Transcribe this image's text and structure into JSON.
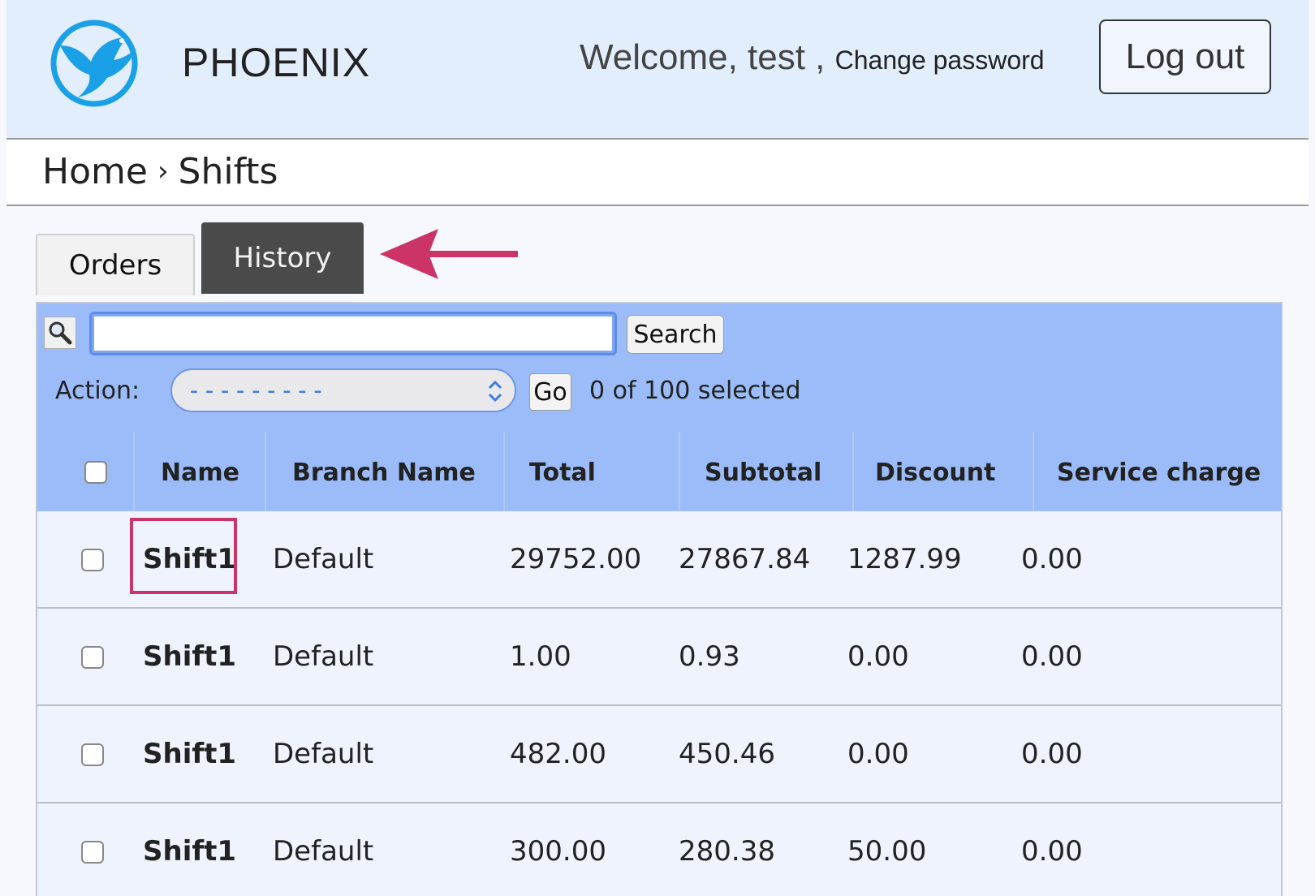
{
  "header": {
    "brand": "PHOENIX",
    "welcome_prefix": "Welcome, ",
    "username": "test",
    "separator": " , ",
    "change_password": "Change password",
    "logout": "Log out"
  },
  "breadcrumb": {
    "home": "Home",
    "separator": "›",
    "current": "Shifts"
  },
  "tabs": [
    {
      "label": "Orders",
      "active": false
    },
    {
      "label": "History",
      "active": true
    }
  ],
  "toolbar": {
    "search_placeholder": "",
    "search_value": "",
    "search_button": "Search",
    "action_label": "Action:",
    "action_selected": "---------",
    "go_button": "Go",
    "selected_count": "0 of 100 selected"
  },
  "table": {
    "columns": [
      "Name",
      "Branch Name",
      "Total",
      "Subtotal",
      "Discount",
      "Service charge"
    ],
    "rows": [
      {
        "name": "Shift1",
        "branch": "Default",
        "total": "29752.00",
        "subtotal": "27867.84",
        "discount": "1287.99",
        "service_charge": "0.00"
      },
      {
        "name": "Shift1",
        "branch": "Default",
        "total": "1.00",
        "subtotal": "0.93",
        "discount": "0.00",
        "service_charge": "0.00"
      },
      {
        "name": "Shift1",
        "branch": "Default",
        "total": "482.00",
        "subtotal": "450.46",
        "discount": "0.00",
        "service_charge": "0.00"
      },
      {
        "name": "Shift1",
        "branch": "Default",
        "total": "300.00",
        "subtotal": "280.38",
        "discount": "50.00",
        "service_charge": "0.00"
      }
    ]
  },
  "colors": {
    "header_bg": "#e3eefd",
    "toolbar_bg": "#9bbcf9",
    "active_tab": "#4a4a4a",
    "annotation": "#cc3366",
    "logo": "#1aa0e6"
  }
}
